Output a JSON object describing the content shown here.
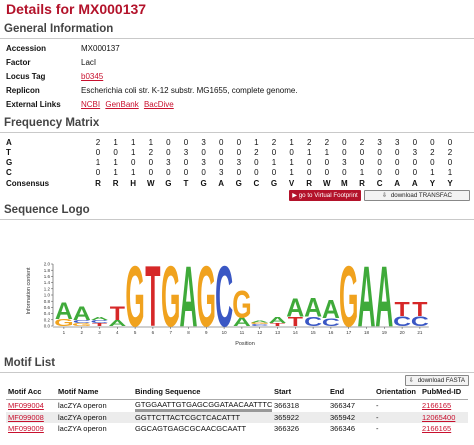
{
  "page_title": "Details for MX000137",
  "general": {
    "heading": "General Information",
    "rows": [
      {
        "key": "Accession",
        "value": "MX000137"
      },
      {
        "key": "Factor",
        "value": "LacI"
      },
      {
        "key": "Locus Tag",
        "value": "b0345"
      },
      {
        "key": "Replicon",
        "value": "Escherichia coli str. K-12 substr. MG1655, complete genome."
      }
    ],
    "external_label": "External Links",
    "external_links": [
      "NCBI",
      "GenBank",
      "BacDive"
    ]
  },
  "frequency": {
    "heading": "Frequency Matrix",
    "rows": [
      {
        "label": "A",
        "values": [
          "2",
          "1",
          "1",
          "1",
          "0",
          "0",
          "3",
          "0",
          "0",
          "1",
          "2",
          "1",
          "2",
          "2",
          "0",
          "2",
          "3",
          "3",
          "0",
          "0",
          "0"
        ]
      },
      {
        "label": "T",
        "values": [
          "0",
          "0",
          "1",
          "2",
          "0",
          "3",
          "0",
          "0",
          "0",
          "2",
          "0",
          "0",
          "1",
          "1",
          "0",
          "0",
          "0",
          "0",
          "3",
          "2",
          "2"
        ]
      },
      {
        "label": "G",
        "values": [
          "1",
          "1",
          "0",
          "0",
          "3",
          "0",
          "3",
          "0",
          "3",
          "0",
          "1",
          "1",
          "0",
          "0",
          "3",
          "0",
          "0",
          "0",
          "0",
          "0",
          "0"
        ]
      },
      {
        "label": "C",
        "values": [
          "0",
          "1",
          "1",
          "0",
          "0",
          "0",
          "0",
          "3",
          "0",
          "0",
          "0",
          "1",
          "0",
          "0",
          "0",
          "1",
          "0",
          "0",
          "0",
          "1",
          "1"
        ]
      },
      {
        "label": "Consensus",
        "values": [
          "R",
          "R",
          "H",
          "W",
          "G",
          "T",
          "G",
          "A",
          "G",
          "C",
          "G",
          "V",
          "R",
          "W",
          "M",
          "R",
          "C",
          "A",
          "A",
          "Y",
          "Y"
        ]
      }
    ],
    "virtual_footprint_label": "go to Virtual Footprint",
    "download_transfac_label": "download TRANSFAC"
  },
  "logo": {
    "heading": "Sequence Logo",
    "ylabel": "Information content",
    "xlabel": "Position",
    "yticks": [
      "0.0",
      "0.2",
      "0.4",
      "0.6",
      "0.8",
      "1.0",
      "1.2",
      "1.4",
      "1.6",
      "1.8",
      "2.0"
    ],
    "xticks": [
      "1",
      "2",
      "3",
      "4",
      "5",
      "6",
      "7",
      "8",
      "9",
      "10",
      "11",
      "12",
      "13",
      "14",
      "15",
      "16",
      "17",
      "18",
      "19",
      "20",
      "21"
    ],
    "colors": {
      "A": "#3faa3a",
      "C": "#3a57c4",
      "G": "#f0a21e",
      "T": "#d62828"
    }
  },
  "chart_data": {
    "type": "sequence_logo",
    "xlabel": "Position",
    "ylabel": "Information content",
    "ylim": [
      0,
      2.0
    ],
    "positions": [
      {
        "pos": 1,
        "stack": [
          [
            "G",
            0.23
          ],
          [
            "A",
            0.55
          ]
        ]
      },
      {
        "pos": 2,
        "stack": [
          [
            "G",
            0.1
          ],
          [
            "C",
            0.1
          ],
          [
            "A",
            0.45
          ]
        ]
      },
      {
        "pos": 3,
        "stack": [
          [
            "T",
            0.1
          ],
          [
            "C",
            0.1
          ],
          [
            "A",
            0.1
          ]
        ]
      },
      {
        "pos": 4,
        "stack": [
          [
            "A",
            0.2
          ],
          [
            "T",
            0.45
          ]
        ]
      },
      {
        "pos": 5,
        "stack": [
          [
            "G",
            2.0
          ]
        ]
      },
      {
        "pos": 6,
        "stack": [
          [
            "T",
            2.0
          ]
        ]
      },
      {
        "pos": 7,
        "stack": [
          [
            "G",
            2.0
          ]
        ]
      },
      {
        "pos": 8,
        "stack": [
          [
            "A",
            2.0
          ]
        ]
      },
      {
        "pos": 9,
        "stack": [
          [
            "G",
            2.0
          ]
        ]
      },
      {
        "pos": 10,
        "stack": [
          [
            "C",
            2.0
          ]
        ]
      },
      {
        "pos": 11,
        "stack": [
          [
            "A",
            0.28
          ],
          [
            "G",
            0.9
          ]
        ]
      },
      {
        "pos": 12,
        "stack": [
          [
            "C",
            0.06
          ],
          [
            "G",
            0.06
          ],
          [
            "A",
            0.06
          ]
        ]
      },
      {
        "pos": 13,
        "stack": [
          [
            "T",
            0.1
          ],
          [
            "A",
            0.2
          ]
        ]
      },
      {
        "pos": 14,
        "stack": [
          [
            "T",
            0.3
          ],
          [
            "A",
            0.6
          ]
        ]
      },
      {
        "pos": 15,
        "stack": [
          [
            "C",
            0.3
          ],
          [
            "A",
            0.62
          ]
        ]
      },
      {
        "pos": 16,
        "stack": [
          [
            "C",
            0.26
          ],
          [
            "A",
            0.6
          ]
        ]
      },
      {
        "pos": 17,
        "stack": [
          [
            "G",
            2.0
          ]
        ]
      },
      {
        "pos": 18,
        "stack": [
          [
            "A",
            2.0
          ]
        ]
      },
      {
        "pos": 19,
        "stack": [
          [
            "A",
            2.0
          ]
        ]
      },
      {
        "pos": 20,
        "stack": [
          [
            "C",
            0.32
          ],
          [
            "T",
            0.48
          ]
        ]
      },
      {
        "pos": 21,
        "stack": [
          [
            "C",
            0.32
          ],
          [
            "T",
            0.48
          ]
        ]
      }
    ]
  },
  "motifs": {
    "heading": "Motif List",
    "download_fasta_label": "download FASTA",
    "columns": [
      "Motif Acc",
      "Motif Name",
      "Binding Sequence",
      "Start",
      "End",
      "Orientation",
      "PubMed-ID"
    ],
    "rows": [
      {
        "acc": "MF099004",
        "name": "lacZYA operon",
        "seq": "GTGGAATTGTGAGCGGATAACAATTTCAC",
        "start": "366318",
        "end": "366347",
        "orientation": "-",
        "pubmed": "2166165"
      },
      {
        "acc": "MF099008",
        "name": "lacZYA operon",
        "seq": "GGTTCTTACTCGCTCACATTT",
        "start": "365922",
        "end": "365942",
        "orientation": "-",
        "pubmed": "12065400"
      },
      {
        "acc": "MF099009",
        "name": "lacZYA operon",
        "seq": "GGCAGTGAGCGCAACGCAATT",
        "start": "366326",
        "end": "366346",
        "orientation": "-",
        "pubmed": "2166165"
      }
    ]
  }
}
